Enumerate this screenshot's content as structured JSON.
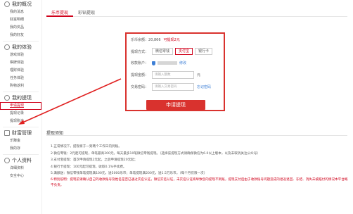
{
  "sidebar": {
    "sections": [
      {
        "title": "我的概况",
        "icon": "person-icon",
        "items": [
          "我的消息",
          "财富明细",
          "我的奖品",
          "我的好友"
        ]
      },
      {
        "title": "我的体验",
        "icon": "experience-icon",
        "items": [
          "游戏体验",
          "棋牌体验",
          "理财体验",
          "任务体验",
          "购物返利"
        ]
      },
      {
        "title": "我的提现",
        "icon": "withdraw-icon",
        "items": [
          "申请提现",
          "提现记录",
          "提现账户"
        ],
        "active_index": 0
      },
      {
        "title": "财富管理",
        "icon": "wealth-icon",
        "items": [
          "乐赚金",
          "我的存"
        ]
      },
      {
        "title": "个人资料",
        "icon": "profile-icon",
        "items": [
          "详细资料",
          "安全中心"
        ]
      }
    ]
  },
  "tabs": [
    "乐币提现",
    "彩钻提现"
  ],
  "form": {
    "balance_label": "乐币余额：",
    "balance_value": "20,866",
    "withdrawable": "可提现2元",
    "method_label": "提现方式：",
    "methods": [
      "微信零钱",
      "支付宝",
      "银行卡"
    ],
    "selected_method_index": 1,
    "account_label": "收款账户：",
    "account_edit": "修改",
    "amount_label": "提现金额：",
    "amount_placeholder": "请输入整数",
    "amount_unit": "元",
    "password_label": "交易密码：",
    "password_placeholder": "请输入交易密码",
    "forgot_password": "忘记密码",
    "submit": "申请提现"
  },
  "notes": {
    "title": "提现须知",
    "lines": [
      "1.正常情况下，提现将于一到两个工作日内到账。",
      "2.微信零钱：2元起可提现，单笔最高200元，每天最多10笔微信零钱提现。（选择该提现方式请确保微信为6.0以上版本，以及未取消关注公众号）",
      "3.支付宝提现：首次申请提现2元起，之后申请提现20元起；",
      "4.银行卡提现：100元起可提现，收取0.1%手续费。",
      "5.满額送：微信零钱单笔提现满100元，送5000乐币；单笔提现满200元，送1.5万乐币。（每个月仅限一次）"
    ],
    "warning": "6.特别说明：提现前请确认自己的收款账号及姓名是否已通过实名认证，微信实名认证，未实名认证将导致您的提现不到账，提现支付后由于收款账号问题造成的退返退回、冻结、消失未被赔付的情况本平台概不负责。"
  },
  "colors": {
    "accent": "#d0021b",
    "link": "#3d7fd6"
  }
}
